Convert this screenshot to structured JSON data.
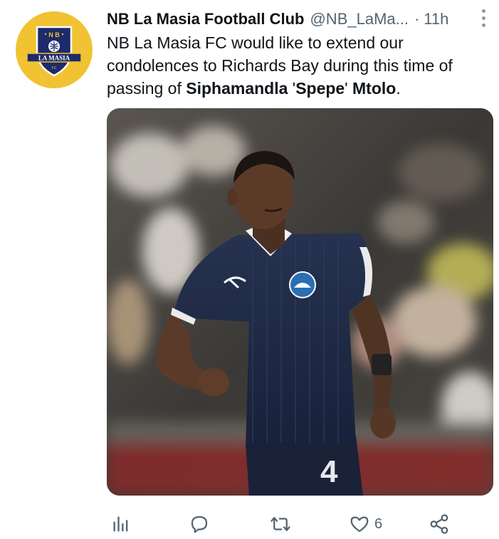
{
  "tweet": {
    "author_name": "NB La Masia Football Club",
    "author_handle": "@NB_LaMa...",
    "separator": "·",
    "time": "11h",
    "text_part1": "NB La Masia FC would like to extend our condolences to Richards Bay during this time of passing of ",
    "text_bold1": "Siphamandla",
    "text_part2": " '",
    "text_bold2": "Spepe",
    "text_part3": "' ",
    "text_bold3": "Mtolo",
    "text_part4": "."
  },
  "avatar": {
    "logo_top_letters": "N B",
    "logo_banner": "LA MASIA",
    "logo_small": "FC",
    "background_color": "#f1c232",
    "shield_color": "#1d2a6b"
  },
  "media": {
    "jersey_number": "4",
    "jersey_color": "#1c2740"
  },
  "actions": {
    "analytics_icon": "analytics-icon",
    "reply_icon": "reply-icon",
    "retweet_icon": "retweet-icon",
    "like_icon": "like-icon",
    "like_count": "6",
    "share_icon": "share-icon",
    "icon_color": "#536471"
  }
}
